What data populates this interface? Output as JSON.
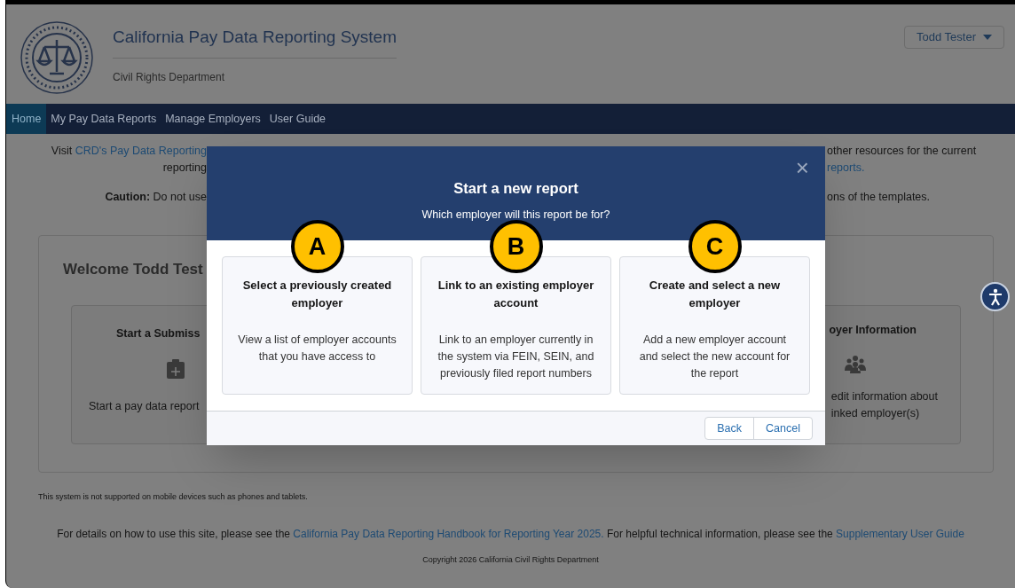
{
  "header": {
    "title": "California Pay Data Reporting System",
    "subtitle": "Civil Rights Department",
    "user_menu": "Todd Tester"
  },
  "nav": [
    {
      "label": "Home",
      "selected": true
    },
    {
      "label": "My Pay Data Reports",
      "selected": false
    },
    {
      "label": "Manage Employers",
      "selected": false
    },
    {
      "label": "User Guide",
      "selected": false
    }
  ],
  "notice_lines": [
    {
      "left": [
        {
          "kind": "text",
          "text": "Visit "
        },
        {
          "kind": "link",
          "text": "CRD's Pay Data Reporting"
        }
      ],
      "right": [
        {
          "kind": "text",
          "text": "other resources for the current"
        }
      ]
    },
    {
      "left": [
        {
          "kind": "text",
          "text": "reporting"
        }
      ],
      "right": [
        {
          "kind": "link",
          "text": "reports."
        }
      ]
    },
    {
      "left": [
        {
          "kind": "text",
          "text": "**Caution:** Do not use"
        }
      ],
      "right": [
        {
          "kind": "text",
          "text": "ons of the templates."
        }
      ]
    }
  ],
  "welcome": {
    "heading": "Welcome Todd Test",
    "cards": [
      {
        "kind": "submission",
        "title": "Start a Submiss",
        "lines": [
          "Start a pay data report"
        ]
      },
      {
        "kind": "employer_info",
        "title": "oyer Information",
        "lines": [
          "edit information about",
          "inked employer(s)"
        ]
      }
    ]
  },
  "modal": {
    "title": "Start a new report",
    "subtitle": "Which employer will this report be for?",
    "close": "×",
    "options": [
      {
        "marker": "A",
        "title": "Select a previously created employer",
        "description": "View a list of employer accounts that you have access to"
      },
      {
        "marker": "B",
        "title": "Link to an existing employer account",
        "description": "Link to an employer currently in the system via FEIN, SEIN, and previously filed report numbers"
      },
      {
        "marker": "C",
        "title": "Create and select a new employer",
        "description": "Add a new employer account and select the new account for the report"
      }
    ],
    "buttons": [
      "Back",
      "Cancel"
    ]
  },
  "footer": {
    "mobile_notice": "This system is not supported on mobile devices such as phones and tablets.",
    "help": [
      {
        "kind": "text",
        "text": "For details on how to use this site, please see the "
      },
      {
        "kind": "link",
        "text": "California Pay Data Reporting Handbook for Reporting Year 2025."
      },
      {
        "kind": "text",
        "text": " For helpful technical information, please see the "
      },
      {
        "kind": "link",
        "text": "Supplementary User Guide"
      }
    ],
    "copyright": "Copyright 2026 California Civil Rights Department"
  }
}
